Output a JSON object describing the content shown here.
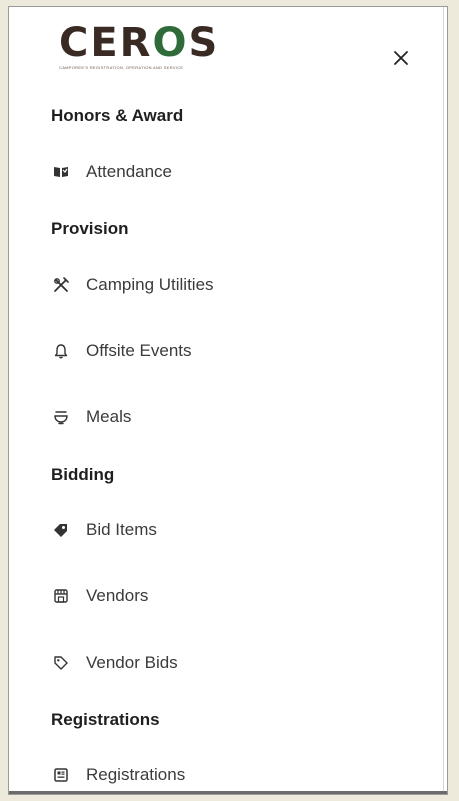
{
  "brand": {
    "logo_text_1": "CER",
    "logo_text_2": "S",
    "tagline": "Camporee's Registration, Operation and Service"
  },
  "close_label": "×",
  "sections": [
    {
      "title": "Honors & Award",
      "items": [
        {
          "label": "Attendance",
          "icon": "book-open-icon"
        }
      ]
    },
    {
      "title": "Provision",
      "items": [
        {
          "label": "Camping Utilities",
          "icon": "utensils-cross-icon"
        },
        {
          "label": "Offsite Events",
          "icon": "bell-icon"
        },
        {
          "label": "Meals",
          "icon": "bowl-icon"
        }
      ]
    },
    {
      "title": "Bidding",
      "items": [
        {
          "label": "Bid Items",
          "icon": "tags-icon"
        },
        {
          "label": "Vendors",
          "icon": "store-icon"
        },
        {
          "label": "Vendor Bids",
          "icon": "tag-icon"
        }
      ]
    },
    {
      "title": "Registrations",
      "items": [
        {
          "label": "Registrations",
          "icon": "id-card-icon"
        }
      ]
    }
  ],
  "colors": {
    "brand_brown": "#3a2a24",
    "brand_green": "#2f6b3a",
    "text_primary": "#1f1f1f",
    "text_secondary": "#3b3b3b"
  }
}
